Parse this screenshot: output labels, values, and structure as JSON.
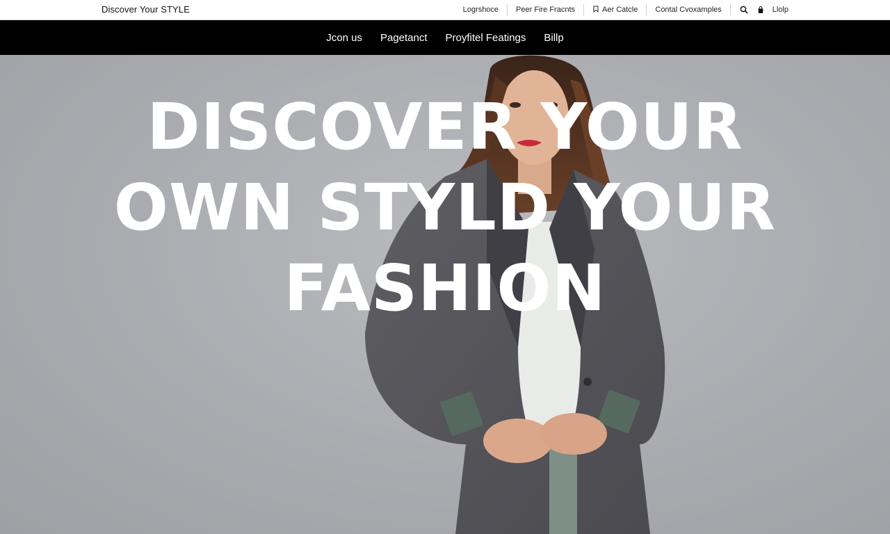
{
  "topbar": {
    "brand": "Discover Your STYLE",
    "links": [
      {
        "label": "Logrshoce",
        "icon": ""
      },
      {
        "label": "Peer Fire Fracnts",
        "icon": ""
      },
      {
        "label": "Aer Catcle",
        "icon": "bookmark-icon"
      },
      {
        "label": "Contal Cvoxamples",
        "icon": ""
      }
    ],
    "icons": [
      "search-icon",
      "bag-icon"
    ],
    "help_label": "Llolp"
  },
  "nav": {
    "items": [
      "Jcon us",
      "Pagetanct",
      "Proyfitel Featings",
      "Billp"
    ]
  },
  "hero": {
    "headline_lines": [
      "DISCOVER YOUR",
      "OWN STYLD YOUR",
      "FASHION"
    ]
  },
  "colors": {
    "nav_background": "#000000",
    "hero_background": "#aeb0b5",
    "headline": "#ffffff"
  }
}
